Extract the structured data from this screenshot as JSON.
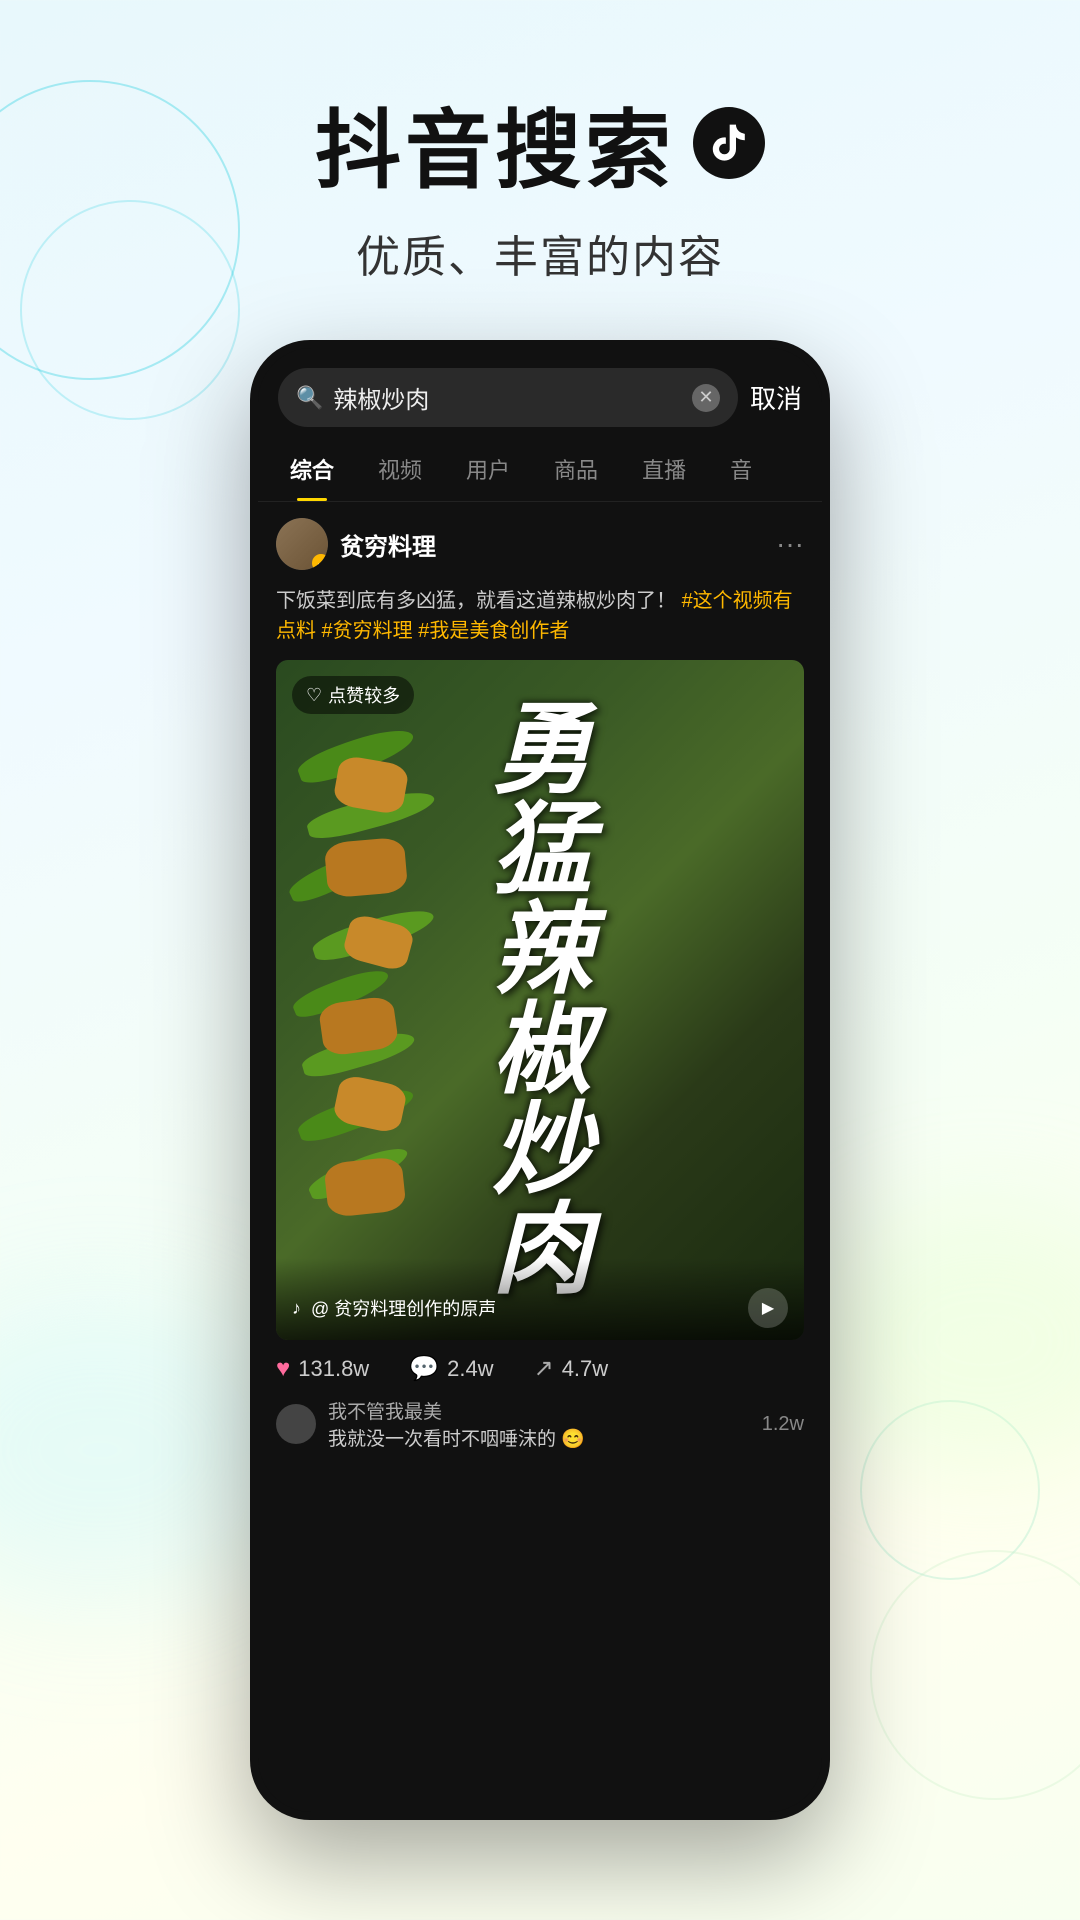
{
  "header": {
    "main_title": "抖音搜索",
    "subtitle": "优质、丰富的内容"
  },
  "search_bar": {
    "query": "辣椒炒肉",
    "cancel_label": "取消"
  },
  "tabs": [
    {
      "label": "综合",
      "active": true
    },
    {
      "label": "视频",
      "active": false
    },
    {
      "label": "用户",
      "active": false
    },
    {
      "label": "商品",
      "active": false
    },
    {
      "label": "直播",
      "active": false
    },
    {
      "label": "音",
      "active": false
    }
  ],
  "post": {
    "username": "贫穷料理",
    "verified": true,
    "caption": "下饭菜到底有多凶猛，就看这道辣椒炒肉了！",
    "hashtags": [
      "#这个视频有点料",
      "#贫穷料理",
      "#我是美食创作者"
    ],
    "like_badge": "点赞较多",
    "video_title": "勇\n猛\n辣\n椒\n炒\n肉",
    "sound_text": "@ 贫穷料理创作的原声",
    "stats": {
      "likes": "131.8w",
      "comments": "2.4w",
      "shares": "4.7w"
    },
    "comment": {
      "user": "我不管我最美",
      "text": "我就没一次看时不咽唾沫的 😊",
      "count": "1.2w"
    }
  }
}
